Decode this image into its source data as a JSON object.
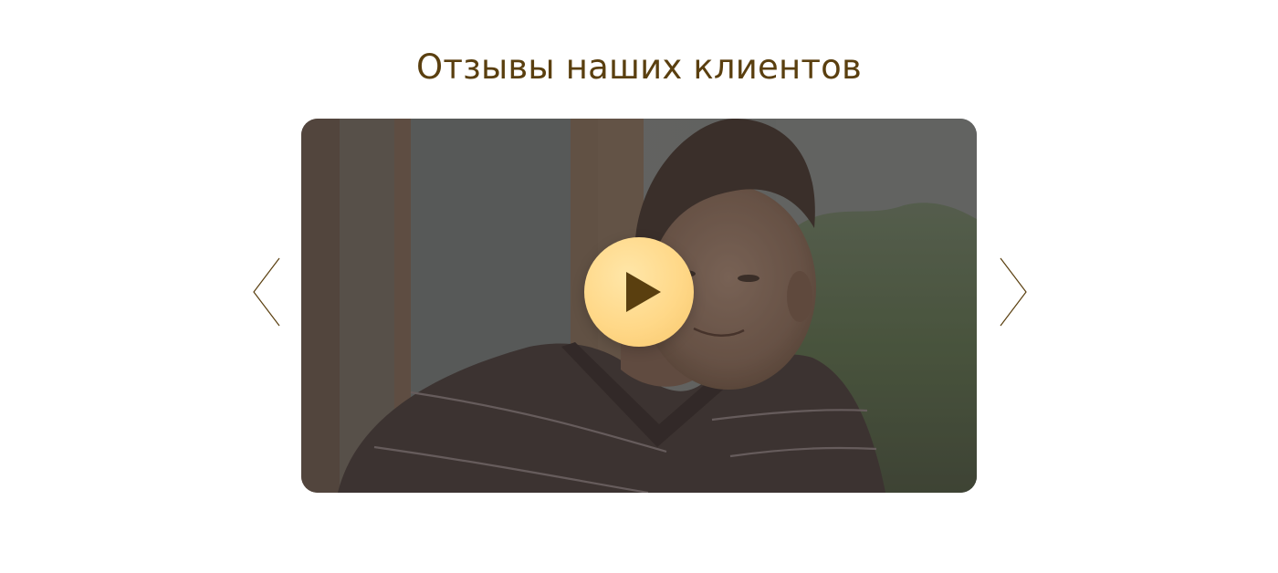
{
  "reviews": {
    "title": "Отзывы наших клиентов",
    "video": {
      "thumbnail_icon": "portrait-photo",
      "play_icon": "play-icon"
    },
    "nav": {
      "prev_icon": "chevron-left-icon",
      "next_icon": "chevron-right-icon"
    }
  },
  "colors": {
    "title": "#5a3f0f",
    "play_button": "#ffd888",
    "play_glyph": "#5a3f0f",
    "arrow": "#5a3f0f",
    "overlay": "#3a3632"
  }
}
